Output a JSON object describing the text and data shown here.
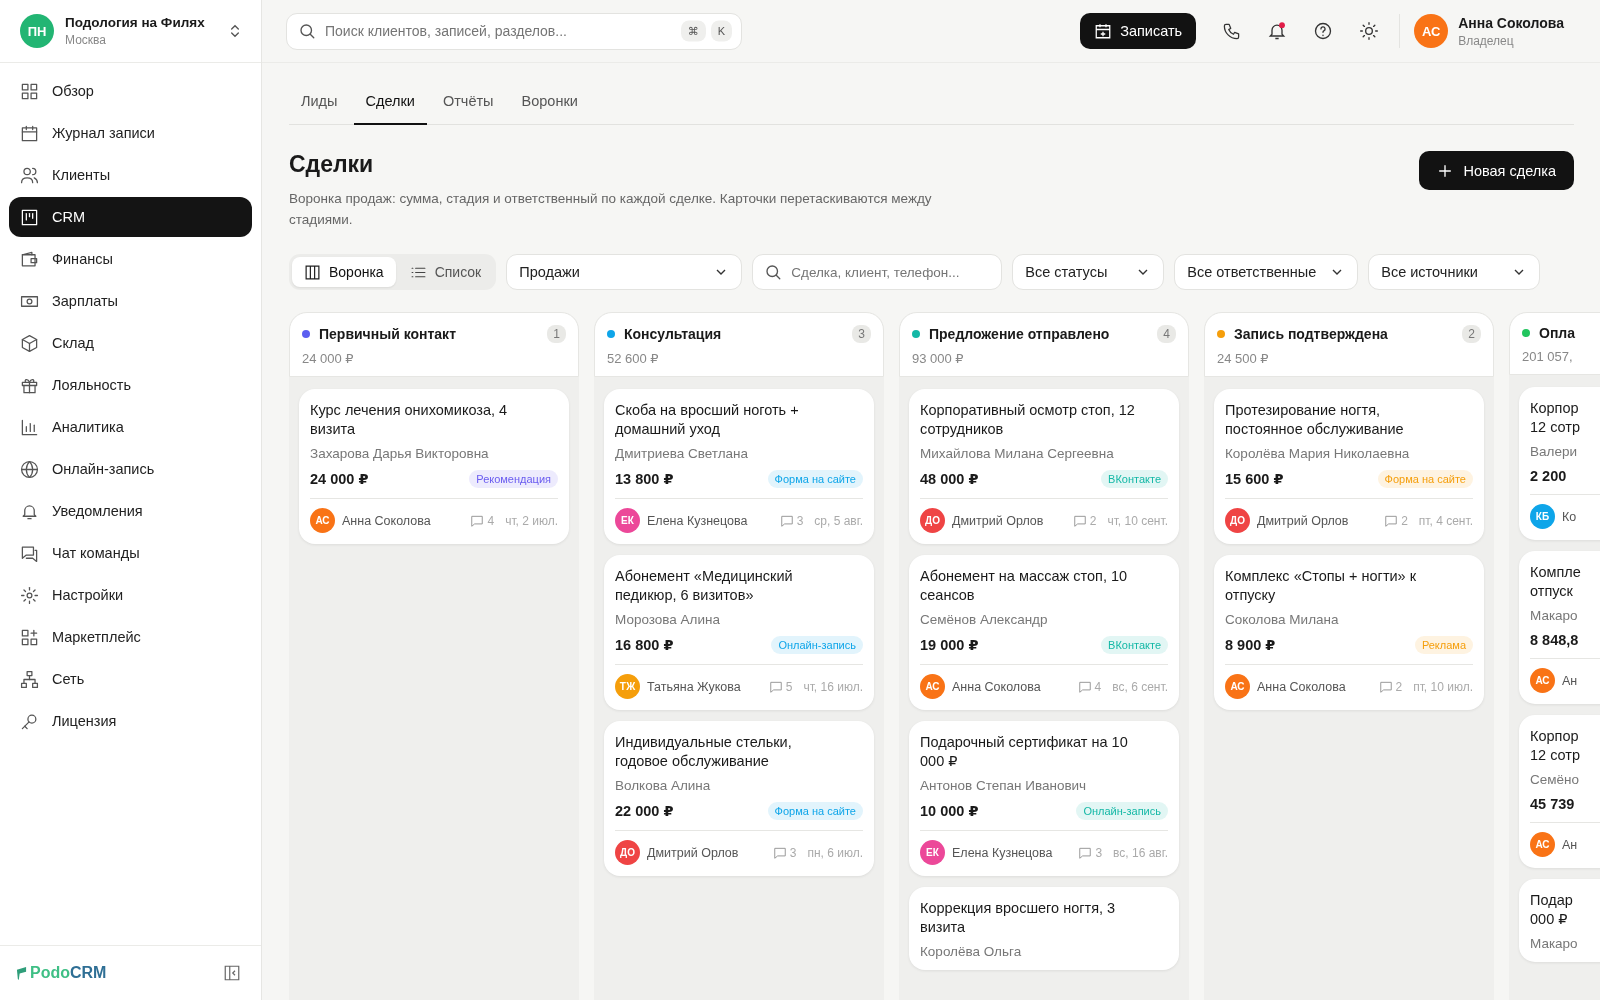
{
  "workspace": {
    "initials": "ПН",
    "name": "Подология на Филях",
    "city": "Москва"
  },
  "sidebar": {
    "items": [
      {
        "label": "Обзор",
        "selected": false
      },
      {
        "label": "Журнал записи",
        "selected": false
      },
      {
        "label": "Клиенты",
        "selected": false
      },
      {
        "label": "CRM",
        "selected": true
      },
      {
        "label": "Финансы",
        "selected": false
      },
      {
        "label": "Зарплаты",
        "selected": false
      },
      {
        "label": "Склад",
        "selected": false
      },
      {
        "label": "Лояльность",
        "selected": false
      },
      {
        "label": "Аналитика",
        "selected": false
      },
      {
        "label": "Онлайн-запись",
        "selected": false
      },
      {
        "label": "Уведомления",
        "selected": false
      },
      {
        "label": "Чат команды",
        "selected": false
      },
      {
        "label": "Настройки",
        "selected": false
      },
      {
        "label": "Маркетплейс",
        "selected": false
      },
      {
        "label": "Сеть",
        "selected": false
      },
      {
        "label": "Лицензия",
        "selected": false
      }
    ],
    "brand": {
      "part_a": "Podo",
      "part_b": "CRM"
    }
  },
  "header": {
    "search": {
      "placeholder": "Поиск клиентов, записей, разделов...",
      "keys": [
        "⌘",
        "K"
      ]
    },
    "book_button": "Записать",
    "notifications_unread": true,
    "user": {
      "initials": "АС",
      "name": "Анна Соколова",
      "role": "Владелец"
    }
  },
  "tabs": [
    {
      "label": "Лиды",
      "selected": false
    },
    {
      "label": "Сделки",
      "selected": true
    },
    {
      "label": "Отчёты",
      "selected": false
    },
    {
      "label": "Воронки",
      "selected": false
    }
  ],
  "page": {
    "title": "Сделки",
    "description": "Воронка продаж: сумма, стадия и ответственный по каждой сделке. Карточки перетаскиваются между стадиями.",
    "new_button": "Новая сделка"
  },
  "toolbar": {
    "views": [
      {
        "label": "Воронка",
        "selected": true
      },
      {
        "label": "Список",
        "selected": false
      }
    ],
    "pipeline": "Продажи",
    "search_placeholder": "Сделка, клиент, телефон...",
    "filters": [
      "Все статусы",
      "Все ответственные",
      "Все источники"
    ]
  },
  "columns": [
    {
      "name": "Первичный контакт",
      "color": "#5b5ef0",
      "count": "1",
      "total": "24 000 ₽",
      "cards": [
        {
          "title": "Курс лечения онихомикоза, 4 визита",
          "client": "Захарова Дарья Викторовна",
          "amount": "24 000 ₽",
          "source": {
            "label": "Рекомендация",
            "color": "#6a5cf0"
          },
          "owner": {
            "initials": "АС",
            "name": "Анна Соколова",
            "color": "#f97316"
          },
          "comments": "4",
          "date": "чт, 2 июл."
        }
      ]
    },
    {
      "name": "Консультация",
      "color": "#0ea5e9",
      "count": "3",
      "total": "52 600 ₽",
      "cards": [
        {
          "title": "Скоба на вросший ноготь + домашний уход",
          "client": "Дмитриева Светлана",
          "amount": "13 800 ₽",
          "source": {
            "label": "Форма на сайте",
            "color": "#0ea5e9"
          },
          "owner": {
            "initials": "ЕК",
            "name": "Елена Кузнецова",
            "color": "#ec4899"
          },
          "comments": "3",
          "date": "ср, 5 авг."
        },
        {
          "title": "Абонемент «Медицинский педикюр, 6 визитов»",
          "client": "Морозова Алина",
          "amount": "16 800 ₽",
          "source": {
            "label": "Онлайн-запись",
            "color": "#0ea5e9"
          },
          "owner": {
            "initials": "ТЖ",
            "name": "Татьяна Жукова",
            "color": "#f59e0b"
          },
          "comments": "5",
          "date": "чт, 16 июл."
        },
        {
          "title": "Индивидуальные стельки, годовое обслуживание",
          "client": "Волкова Алина",
          "amount": "22 000 ₽",
          "source": {
            "label": "Форма на сайте",
            "color": "#0ea5e9"
          },
          "owner": {
            "initials": "ДО",
            "name": "Дмитрий Орлов",
            "color": "#ef4444"
          },
          "comments": "3",
          "date": "пн, 6 июл."
        }
      ]
    },
    {
      "name": "Предложение отправлено",
      "color": "#14b8a6",
      "count": "4",
      "total": "93 000 ₽",
      "cards": [
        {
          "title": "Корпоративный осмотр стоп, 12 сотрудников",
          "client": "Михайлова Милана Сергеевна",
          "amount": "48 000 ₽",
          "source": {
            "label": "ВКонтакте",
            "color": "#14b8a6"
          },
          "owner": {
            "initials": "ДО",
            "name": "Дмитрий Орлов",
            "color": "#ef4444"
          },
          "comments": "2",
          "date": "чт, 10 сент."
        },
        {
          "title": "Абонемент на массаж стоп, 10 сеансов",
          "client": "Семёнов Александр",
          "amount": "19 000 ₽",
          "source": {
            "label": "ВКонтакте",
            "color": "#14b8a6"
          },
          "owner": {
            "initials": "АС",
            "name": "Анна Соколова",
            "color": "#f97316"
          },
          "comments": "4",
          "date": "вс, 6 сент."
        },
        {
          "title": "Подарочный сертификат на 10 000 ₽",
          "client": "Антонов Степан Иванович",
          "amount": "10 000 ₽",
          "source": {
            "label": "Онлайн-запись",
            "color": "#14b8a6"
          },
          "owner": {
            "initials": "ЕК",
            "name": "Елена Кузнецова",
            "color": "#ec4899"
          },
          "comments": "3",
          "date": "вс, 16 авг."
        },
        {
          "title": "Коррекция вросшего ногтя, 3 визита",
          "client": "Королёва Ольга"
        }
      ]
    },
    {
      "name": "Запись подтверждена",
      "color": "#f59e0b",
      "count": "2",
      "total": "24 500 ₽",
      "cards": [
        {
          "title": "Протезирование ногтя, постоянное обслуживание",
          "client": "Королёва Мария Николаевна",
          "amount": "15 600 ₽",
          "source": {
            "label": "Форма на сайте",
            "color": "#f59e0b"
          },
          "owner": {
            "initials": "ДО",
            "name": "Дмитрий Орлов",
            "color": "#ef4444"
          },
          "comments": "2",
          "date": "пт, 4 сент."
        },
        {
          "title": "Комплекс «Стопы + ногти» к отпуску",
          "client": "Соколова Милана",
          "amount": "8 900 ₽",
          "source": {
            "label": "Реклама",
            "color": "#f59e0b"
          },
          "owner": {
            "initials": "АС",
            "name": "Анна Соколова",
            "color": "#f97316"
          },
          "comments": "2",
          "date": "пт, 10 июл."
        }
      ]
    },
    {
      "name": "Опла",
      "color": "#22c55e",
      "total": "201 057,",
      "cards": [
        {
          "title": "Корпор\n12 сотр",
          "client": "Валери",
          "amount": "2 200",
          "owner": {
            "initials": "КБ",
            "name": "Ко",
            "color": "#0ea5e9"
          }
        },
        {
          "title": "Компле\nотпуск",
          "client": "Макаро",
          "amount": "8 848,8",
          "owner": {
            "initials": "АС",
            "name": "Ан",
            "color": "#f97316"
          }
        },
        {
          "title": "Корпор\n12 сотр",
          "client": "Семёно",
          "amount": "45 739",
          "owner": {
            "initials": "АС",
            "name": "Ан",
            "color": "#f97316"
          }
        },
        {
          "title": "Подар\n000 ₽",
          "client": "Макаро"
        }
      ]
    }
  ]
}
